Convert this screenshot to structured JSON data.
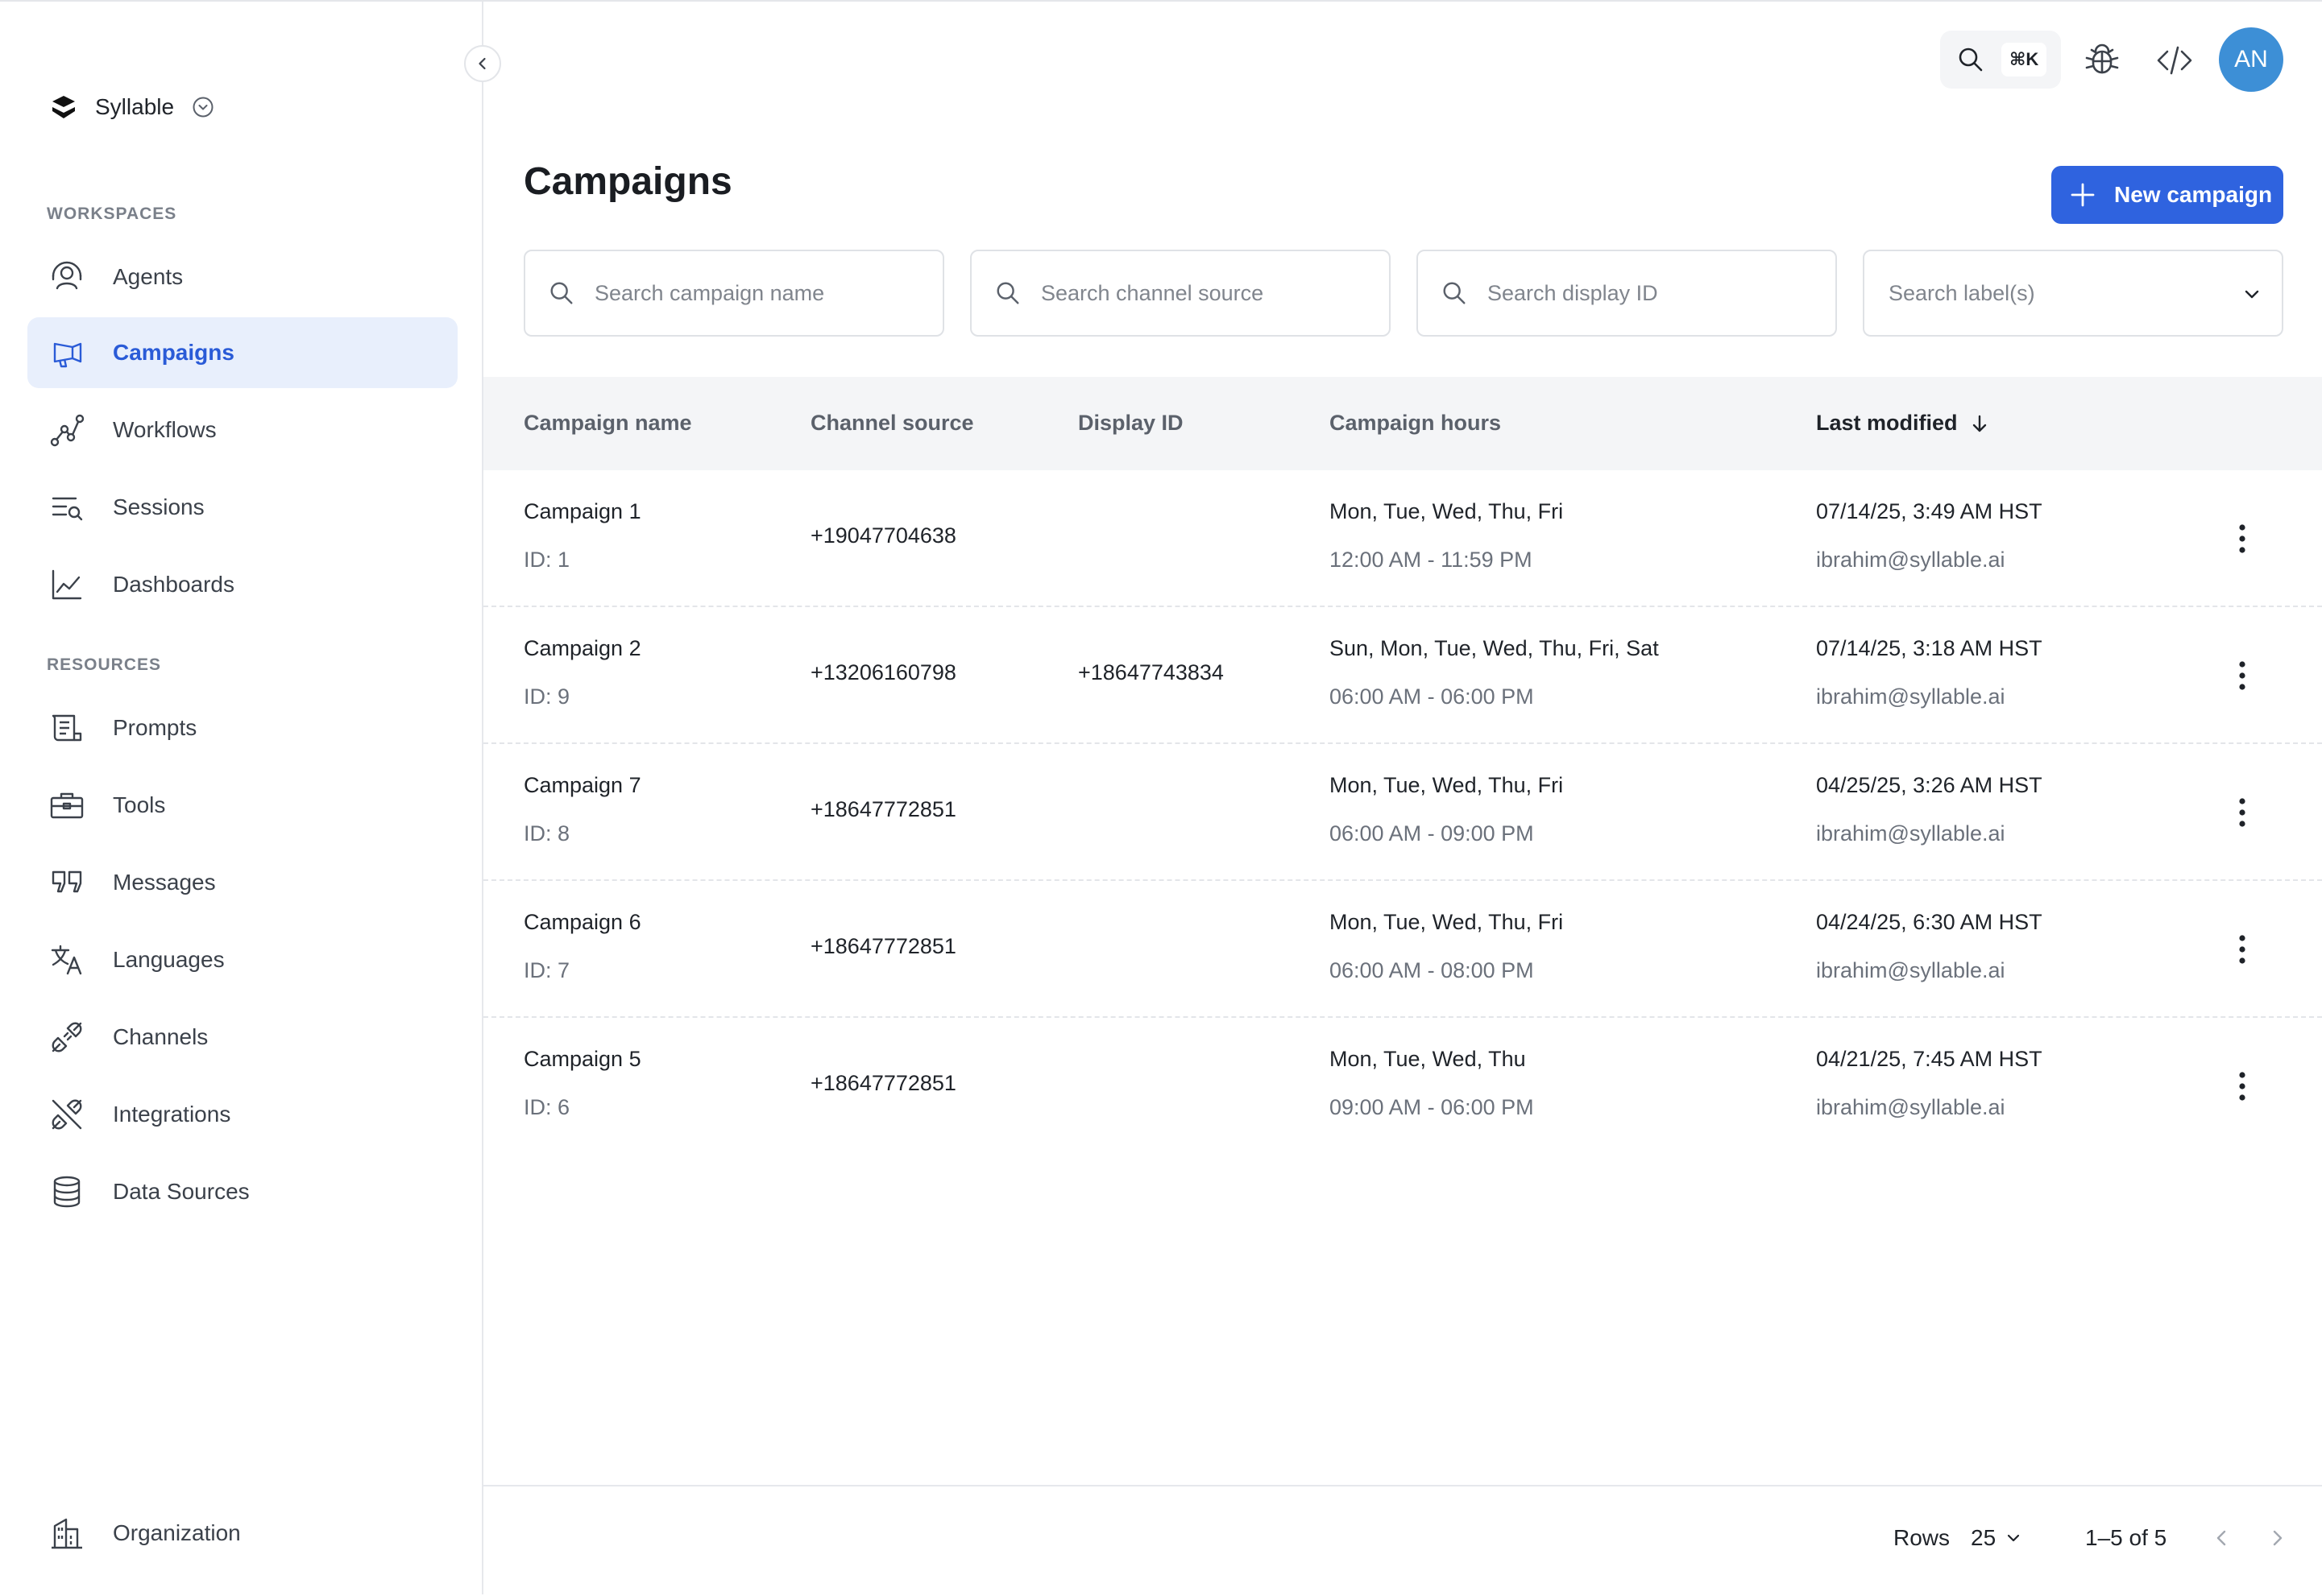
{
  "brand": {
    "name": "Syllable"
  },
  "sidebar": {
    "sections": [
      {
        "label": "WORKSPACES"
      },
      {
        "label": "RESOURCES"
      }
    ],
    "workspaces": [
      {
        "label": "Agents",
        "icon": "agents-icon"
      },
      {
        "label": "Campaigns",
        "icon": "campaigns-icon",
        "active": true
      },
      {
        "label": "Workflows",
        "icon": "workflows-icon"
      },
      {
        "label": "Sessions",
        "icon": "sessions-icon"
      },
      {
        "label": "Dashboards",
        "icon": "dashboards-icon"
      }
    ],
    "resources": [
      {
        "label": "Prompts",
        "icon": "prompts-icon"
      },
      {
        "label": "Tools",
        "icon": "tools-icon"
      },
      {
        "label": "Messages",
        "icon": "messages-icon"
      },
      {
        "label": "Languages",
        "icon": "languages-icon"
      },
      {
        "label": "Channels",
        "icon": "channels-icon"
      },
      {
        "label": "Integrations",
        "icon": "integrations-icon"
      },
      {
        "label": "Data Sources",
        "icon": "data-sources-icon"
      }
    ],
    "footer_item": {
      "label": "Organization",
      "icon": "organization-icon"
    }
  },
  "topbar": {
    "shortcut": "⌘K",
    "avatar_initials": "AN"
  },
  "page": {
    "title": "Campaigns",
    "new_button": "New campaign"
  },
  "filters": {
    "campaign_name_placeholder": "Search campaign name",
    "channel_source_placeholder": "Search channel source",
    "display_id_placeholder": "Search display ID",
    "labels_placeholder": "Search label(s)"
  },
  "table": {
    "columns": {
      "name": "Campaign name",
      "channel": "Channel source",
      "display_id": "Display ID",
      "hours": "Campaign hours",
      "modified": "Last modified"
    },
    "rows": [
      {
        "name": "Campaign 1",
        "id": "ID: 1",
        "channel": "+19047704638",
        "display_id": "",
        "days": "Mon, Tue, Wed, Thu, Fri",
        "hours": "12:00 AM - 11:59 PM",
        "modified": "07/14/25, 3:49 AM HST",
        "modified_by": "ibrahim@syllable.ai"
      },
      {
        "name": "Campaign 2",
        "id": "ID: 9",
        "channel": "+13206160798",
        "display_id": "+18647743834",
        "days": "Sun, Mon, Tue, Wed, Thu, Fri, Sat",
        "hours": "06:00 AM - 06:00 PM",
        "modified": "07/14/25, 3:18 AM HST",
        "modified_by": "ibrahim@syllable.ai"
      },
      {
        "name": "Campaign 7",
        "id": "ID: 8",
        "channel": "+18647772851",
        "display_id": "",
        "days": "Mon, Tue, Wed, Thu, Fri",
        "hours": "06:00 AM - 09:00 PM",
        "modified": "04/25/25, 3:26 AM HST",
        "modified_by": "ibrahim@syllable.ai"
      },
      {
        "name": "Campaign 6",
        "id": "ID: 7",
        "channel": "+18647772851",
        "display_id": "",
        "days": "Mon, Tue, Wed, Thu, Fri",
        "hours": "06:00 AM - 08:00 PM",
        "modified": "04/24/25, 6:30 AM HST",
        "modified_by": "ibrahim@syllable.ai"
      },
      {
        "name": "Campaign 5",
        "id": "ID: 6",
        "channel": "+18647772851",
        "display_id": "",
        "days": "Mon, Tue, Wed, Thu",
        "hours": "09:00 AM - 06:00 PM",
        "modified": "04/21/25, 7:45 AM HST",
        "modified_by": "ibrahim@syllable.ai"
      }
    ]
  },
  "pagination": {
    "rows_label": "Rows",
    "rows_value": "25",
    "range": "1–5 of 5"
  },
  "colors": {
    "accent": "#2f63df",
    "active_bg": "#e8effc",
    "avatar": "#3d8fd6"
  }
}
